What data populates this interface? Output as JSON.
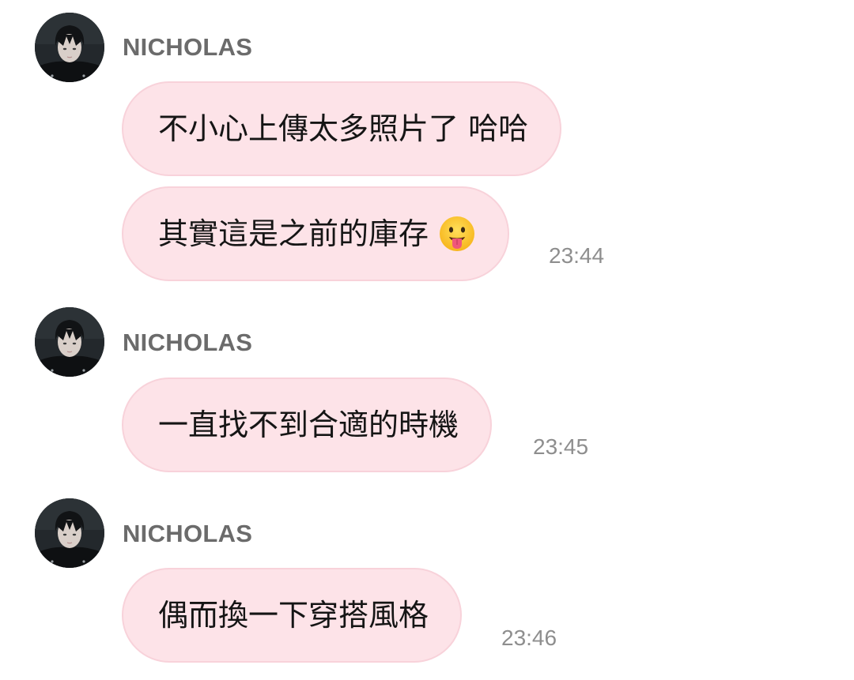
{
  "messages": [
    {
      "sender": "NICHOLAS",
      "bubbles": [
        {
          "text": "不小心上傳太多照片了 哈哈",
          "time": ""
        },
        {
          "text": "其實這是之前的庫存",
          "emoji": "face-with-tongue-icon",
          "time": "23:44"
        }
      ]
    },
    {
      "sender": "NICHOLAS",
      "bubbles": [
        {
          "text": "一直找不到合適的時機",
          "time": "23:45"
        }
      ]
    },
    {
      "sender": "NICHOLAS",
      "bubbles": [
        {
          "text": "偶而換一下穿搭風格",
          "time": "23:46"
        }
      ]
    }
  ],
  "colors": {
    "bubble_bg": "#fde3e8",
    "bubble_border": "#f8d2da",
    "sender": "#6b6b6b",
    "timestamp": "#8e8e8e",
    "text": "#151515"
  }
}
